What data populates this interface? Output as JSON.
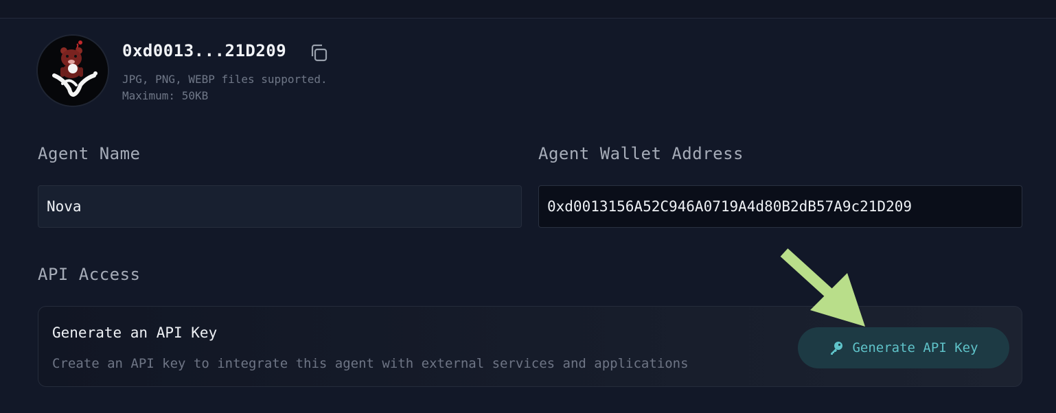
{
  "profile": {
    "wallet_short": "0xd0013...21D209",
    "hint_line1": "JPG, PNG, WEBP files supported.",
    "hint_line2": "Maximum: 50KB"
  },
  "form": {
    "agent_name_label": "Agent Name",
    "agent_name_value": "Nova",
    "wallet_label": "Agent Wallet Address",
    "wallet_value": "0xd0013156A52C946A0719A4d80B2dB57A9c21D209"
  },
  "api": {
    "section_label": "API Access",
    "card_title": "Generate an API Key",
    "card_description": "Create an API key to integrate this agent with external services and applications",
    "button_label": "Generate API Key"
  },
  "icons": {
    "copy": "copy-icon",
    "key": "key-icon",
    "annotation_arrow": "arrow-icon"
  },
  "colors": {
    "background": "#121828",
    "accent": "#5fc3c9",
    "button_bg": "#1d3a44",
    "annotation_arrow": "#b9de8a"
  }
}
